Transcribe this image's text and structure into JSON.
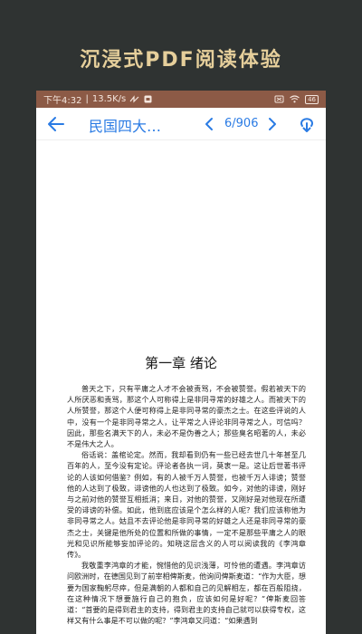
{
  "headline": "沉浸式PDF阅读体验",
  "status_bar": {
    "time": "下午4:32",
    "speed": "13.5K/s",
    "battery": "46"
  },
  "toolbar": {
    "title": "民国四大…",
    "page_indicator": "6/906"
  },
  "document": {
    "chapter_title": "第一章 绪论",
    "paragraphs": [
      "普天之下，只有平庸之人才不会被责骂，不会被赞誉。假若被天下的人所厌恶和责骂，那这个人可称得上是非同寻常的好雄之人。而被天下的人所赞誉，那这个人便可称得上是非同寻常的豪杰之士。在这些评说的人中，没有一个是非同寻常之人，让平常之人评论非同寻常之人，可信吗？因此，那些名满天下的人，未必不是伪善之人；那些臭名昭著的人，未必不是伟大之人。",
      "俗话说：盖棺论定。然而，我却看到仍有一些已经去世几十年甚至几百年的人，至今没有定论。评论者各执一词，莫衷一是。这让后世著书评论的人该如何借鉴？例如，有的人被千万人赞誉，也被千万人诽谤；赞誉他的人达到了极致，诽谤他的人也达到了极致。如今，对他的诽谤，刚好与之前对他的赞誉互相抵消；来日，对他的赞誉，又刚好是对他现在所遭受的诽谤的补偿。如此，他到底应该是个怎么样的人呢？我们应该称他为非同寻常之人。姑且不去评论他是非同寻常的好雄之人还是非同寻常的豪杰之士，关键是他所处的位置和所做的事情，一定不是那些平庸之人的眼光和见识所能够妄加评论的。知晓这层含义的人可以阅读我的《李鸿章传》。",
      "我敬重李鸿章的才能，惋惜他的见识浅薄，可怜他的遭遇。李鸿章访问欧洲时，在德国见到了前宰相俾斯麦，他询问俾斯麦道：“作为大臣，想要为国家鞠躬尽瘁，但是满朝的人都和自己的见解相左，都在百般阻挠，在这种情况下想要施行自己的抱负，应该如何是好呢？”俾斯麦回答道：“首要的是得到君主的支持，得到君主的支持自己就可以获得专权，这样又有什么事是不可以做的呢？”李鸿章又问道：“如果遇到"
    ]
  },
  "icons": {
    "back": "arrow-left-icon",
    "prev": "chevron-left-icon",
    "next": "chevron-right-icon",
    "share": "share-icon"
  },
  "colors": {
    "accent": "#2a7be4",
    "status_bar": "#8c5a46",
    "backdrop": "#2f3332",
    "headline": "#e6cf9b"
  }
}
